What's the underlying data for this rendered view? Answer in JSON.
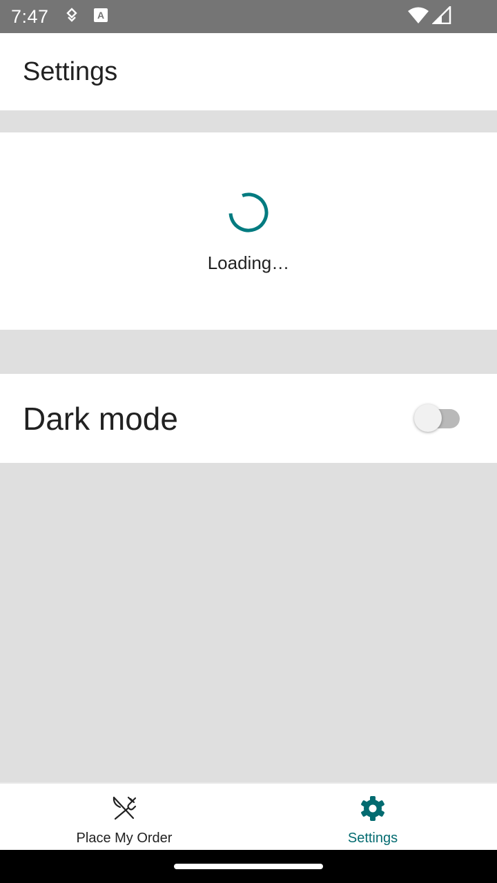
{
  "status_bar": {
    "time": "7:47",
    "left_icons": [
      "data-saver-icon",
      "text-accessibility-icon"
    ],
    "right_icons": [
      "wifi-icon",
      "cell-signal-icon"
    ]
  },
  "header": {
    "title": "Settings"
  },
  "loading": {
    "text": "Loading…",
    "accent_color": "#037b80"
  },
  "dark_mode": {
    "label": "Dark mode",
    "enabled": false
  },
  "bottom_nav": {
    "items": [
      {
        "label": "Place My Order",
        "icon": "fork-knife-icon",
        "active": false
      },
      {
        "label": "Settings",
        "icon": "gear-icon",
        "active": true
      }
    ],
    "active_color": "#036b70"
  }
}
